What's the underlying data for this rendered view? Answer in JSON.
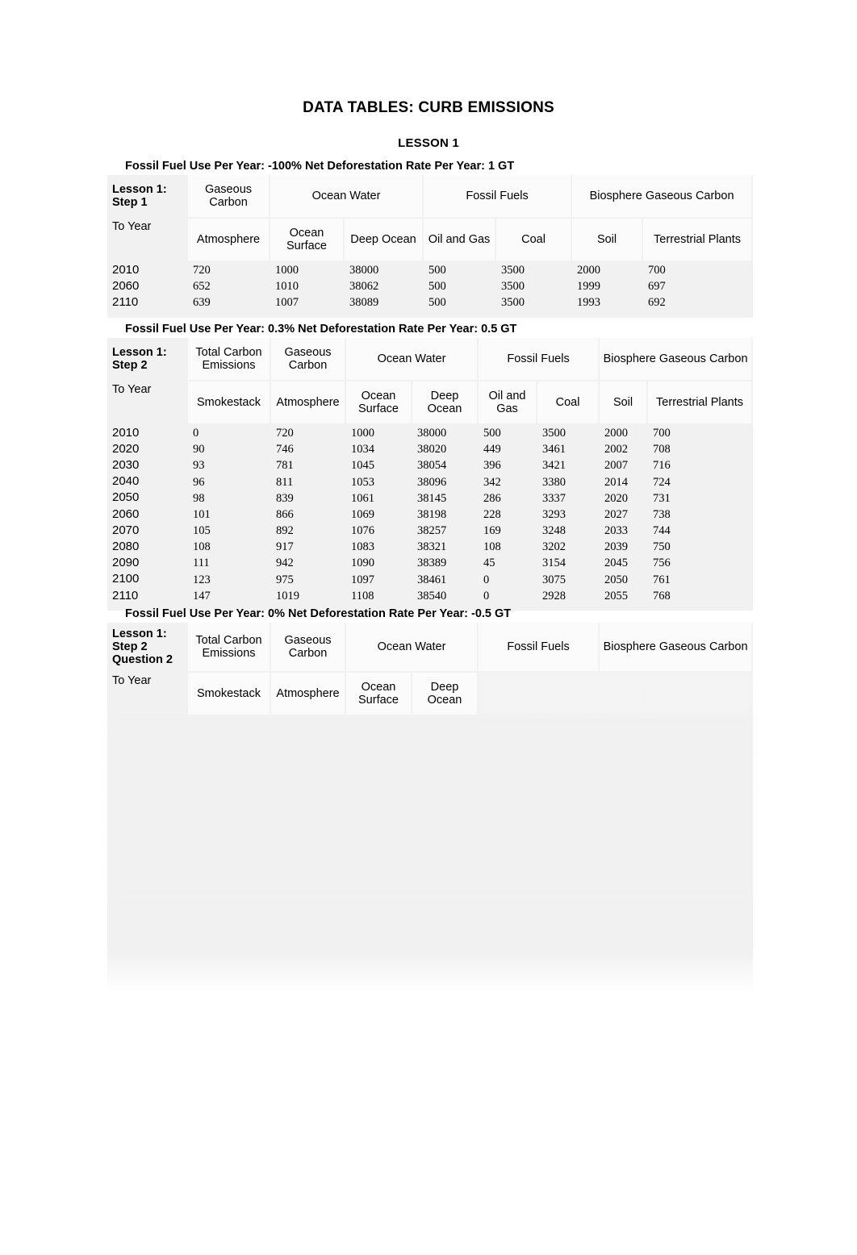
{
  "document": {
    "title": "DATA TABLES: CURB EMISSIONS",
    "subtitle": "LESSON 1"
  },
  "tables": [
    {
      "caption": "Fossil Fuel Use Per Year: -100% Net Deforestation Rate Per Year: 1 GT",
      "corner_line1": "Lesson 1:",
      "corner_line2": "Step 1",
      "corner_line3": "",
      "row_header_label": "To Year",
      "group_headers": [
        "Gaseous Carbon",
        "Ocean Water",
        "Fossil Fuels",
        "Biosphere Gaseous Carbon"
      ],
      "columns": [
        "Atmosphere",
        "Ocean Surface",
        "Deep Ocean",
        "Oil and Gas",
        "Coal",
        "Soil",
        "Terrestrial Plants"
      ],
      "rows": [
        {
          "year": "2010",
          "values": [
            "720",
            "1000",
            "38000",
            "500",
            "3500",
            "2000",
            "700"
          ]
        },
        {
          "year": "2060",
          "values": [
            "652",
            "1010",
            "38062",
            "500",
            "3500",
            "1999",
            "697"
          ]
        },
        {
          "year": "2110",
          "values": [
            "639",
            "1007",
            "38089",
            "500",
            "3500",
            "1993",
            "692"
          ]
        }
      ]
    },
    {
      "caption": "Fossil Fuel Use Per Year: 0.3% Net Deforestation Rate Per Year: 0.5 GT",
      "corner_line1": "Lesson 1:",
      "corner_line2": "Step 2",
      "corner_line3": "",
      "row_header_label": "To Year",
      "group_headers": [
        "Total Carbon Emissions",
        "Gaseous Carbon",
        "Ocean Water",
        "Fossil Fuels",
        "Biosphere Gaseous Carbon"
      ],
      "columns": [
        "Smokestack",
        "Atmosphere",
        "Ocean Surface",
        "Deep Ocean",
        "Oil and Gas",
        "Coal",
        "Soil",
        "Terrestrial Plants"
      ],
      "rows": [
        {
          "year": "2010",
          "values": [
            "0",
            "720",
            "1000",
            "38000",
            "500",
            "3500",
            "2000",
            "700"
          ]
        },
        {
          "year": "2020",
          "values": [
            "90",
            "746",
            "1034",
            "38020",
            "449",
            "3461",
            "2002",
            "708"
          ]
        },
        {
          "year": "2030",
          "values": [
            "93",
            "781",
            "1045",
            "38054",
            "396",
            "3421",
            "2007",
            "716"
          ]
        },
        {
          "year": "2040",
          "values": [
            "96",
            "811",
            "1053",
            "38096",
            "342",
            "3380",
            "2014",
            "724"
          ]
        },
        {
          "year": "2050",
          "values": [
            "98",
            "839",
            "1061",
            "38145",
            "286",
            "3337",
            "2020",
            "731"
          ]
        },
        {
          "year": "2060",
          "values": [
            "101",
            "866",
            "1069",
            "38198",
            "228",
            "3293",
            "2027",
            "738"
          ]
        },
        {
          "year": "2070",
          "values": [
            "105",
            "892",
            "1076",
            "38257",
            "169",
            "3248",
            "2033",
            "744"
          ]
        },
        {
          "year": "2080",
          "values": [
            "108",
            "917",
            "1083",
            "38321",
            "108",
            "3202",
            "2039",
            "750"
          ]
        },
        {
          "year": "2090",
          "values": [
            "111",
            "942",
            "1090",
            "38389",
            "45",
            "3154",
            "2045",
            "756"
          ]
        },
        {
          "year": "2100",
          "values": [
            "123",
            "975",
            "1097",
            "38461",
            "0",
            "3075",
            "2050",
            "761"
          ]
        },
        {
          "year": "2110",
          "values": [
            "147",
            "1019",
            "1108",
            "38540",
            "0",
            "2928",
            "2055",
            "768"
          ]
        }
      ]
    },
    {
      "caption": "Fossil Fuel Use Per Year: 0% Net Deforestation Rate Per Year: -0.5 GT",
      "corner_line1": "Lesson 1:",
      "corner_line2": "Step 2",
      "corner_line3": "Question 2",
      "row_header_label": "To Year",
      "group_headers": [
        "Total Carbon Emissions",
        "Gaseous Carbon",
        "Ocean Water",
        "Fossil Fuels",
        "Biosphere Gaseous Carbon"
      ],
      "columns": [
        "Smokestack",
        "Atmosphere",
        "Ocean Surface",
        "Deep Ocean",
        "",
        "",
        "",
        ""
      ],
      "rows": [
        {
          "year": "",
          "values": [
            "",
            "",
            "",
            "",
            "",
            "",
            "",
            ""
          ]
        },
        {
          "year": "",
          "values": [
            "",
            "",
            "",
            "",
            "",
            "",
            "",
            ""
          ]
        },
        {
          "year": "",
          "values": [
            "",
            "",
            "",
            "",
            "",
            "",
            "",
            ""
          ]
        },
        {
          "year": "",
          "values": [
            "",
            "",
            "",
            "",
            "",
            "",
            "",
            ""
          ]
        },
        {
          "year": "",
          "values": [
            "",
            "",
            "",
            "",
            "",
            "",
            "",
            ""
          ]
        },
        {
          "year": "",
          "values": [
            "",
            "",
            "",
            "",
            "",
            "",
            "",
            ""
          ]
        },
        {
          "year": "",
          "values": [
            "",
            "",
            "",
            "",
            "",
            "",
            "",
            ""
          ]
        },
        {
          "year": "",
          "values": [
            "",
            "",
            "",
            "",
            "",
            "",
            "",
            ""
          ]
        },
        {
          "year": "",
          "values": [
            "",
            "",
            "",
            "",
            "",
            "",
            "",
            ""
          ]
        },
        {
          "year": "",
          "values": [
            "",
            "",
            "",
            "",
            "",
            "",
            "",
            ""
          ]
        },
        {
          "year": "",
          "values": [
            "",
            "",
            "",
            "",
            "",
            "",
            "",
            ""
          ]
        }
      ]
    }
  ],
  "colors": {
    "page_background": "#ffffff",
    "table_background": "#f1f1f1",
    "header_cell_background": "#fbfbfb",
    "text": "#000000"
  }
}
